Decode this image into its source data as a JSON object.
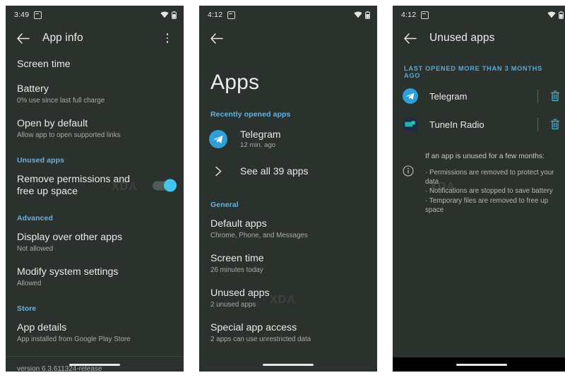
{
  "screens": [
    {
      "id": "app-info",
      "status": {
        "time": "3:49",
        "notif_icon": "notification-square-icon",
        "wifi_icon": "wifi-icon",
        "battery_icon": "battery-icon"
      },
      "appbar": {
        "back_icon": "back-arrow-icon",
        "title": "App info",
        "overflow_icon": "overflow-menu-icon"
      },
      "rows": [
        {
          "title": "Screen time",
          "sub": ""
        },
        {
          "title": "Battery",
          "sub": "0% use since last full charge"
        },
        {
          "title": "Open by default",
          "sub": "Allow app to open supported links"
        }
      ],
      "section_unused": "Unused apps",
      "unused_row": {
        "title": "Remove permissions and free up space",
        "toggle_on": true
      },
      "section_advanced": "Advanced",
      "advanced_rows": [
        {
          "title": "Display over other apps",
          "sub": "Not allowed"
        },
        {
          "title": "Modify system settings",
          "sub": "Allowed"
        }
      ],
      "section_store": "Store",
      "store_row": {
        "title": "App details",
        "sub": "App installed from Google Play Store"
      },
      "version": "version 6.3.611324-release",
      "watermark": "XDA"
    },
    {
      "id": "apps",
      "status": {
        "time": "4:12",
        "notif_icon": "notification-square-icon",
        "wifi_icon": "wifi-icon",
        "battery_icon": "battery-icon"
      },
      "appbar": {
        "back_icon": "back-arrow-icon",
        "title": "",
        "overflow_icon": ""
      },
      "page_title": "Apps",
      "section_recent": "Recently opened apps",
      "recent_app": {
        "name": "Telegram",
        "sub": "12 min. ago",
        "icon": "telegram-icon"
      },
      "see_all": {
        "label": "See all 39 apps",
        "icon": "chevron-right-icon"
      },
      "section_general": "General",
      "general_rows": [
        {
          "title": "Default apps",
          "sub": "Chrome, Phone, and Messages"
        },
        {
          "title": "Screen time",
          "sub": "26 minutes today"
        },
        {
          "title": "Unused apps",
          "sub": "2 unused apps"
        },
        {
          "title": "Special app access",
          "sub": "2 apps can use unrestricted data"
        }
      ],
      "watermark": "XDA"
    },
    {
      "id": "unused-apps",
      "status": {
        "time": "4:12",
        "notif_icon": "notification-square-icon",
        "wifi_icon": "wifi-icon",
        "battery_icon": "battery-icon"
      },
      "appbar": {
        "back_icon": "back-arrow-icon",
        "title": "Unused apps",
        "overflow_icon": ""
      },
      "section_header": "LAST OPENED MORE THAN 3 MONTHS AGO",
      "apps": [
        {
          "name": "Telegram",
          "icon": "telegram-icon",
          "delete_icon": "trash-icon"
        },
        {
          "name": "TuneIn Radio",
          "icon": "tunein-radio-icon",
          "delete_icon": "trash-icon"
        }
      ],
      "info": {
        "icon": "info-circle-icon",
        "heading": "If an app is unused for a few months:",
        "bullets": [
          "· Permissions are removed to protect your data",
          "· Notifications are stopped to save battery",
          "· Temporary files are removed to free up space"
        ]
      },
      "watermark": "XDA"
    }
  ],
  "colors": {
    "background": "#2b312d",
    "accent": "#63b3e6",
    "toggle_on": "#43c5ef",
    "trash": "#46c8ea",
    "text_primary": "#e9ebe9",
    "text_secondary": "#a8aca8",
    "navbar_black": "#000000"
  }
}
